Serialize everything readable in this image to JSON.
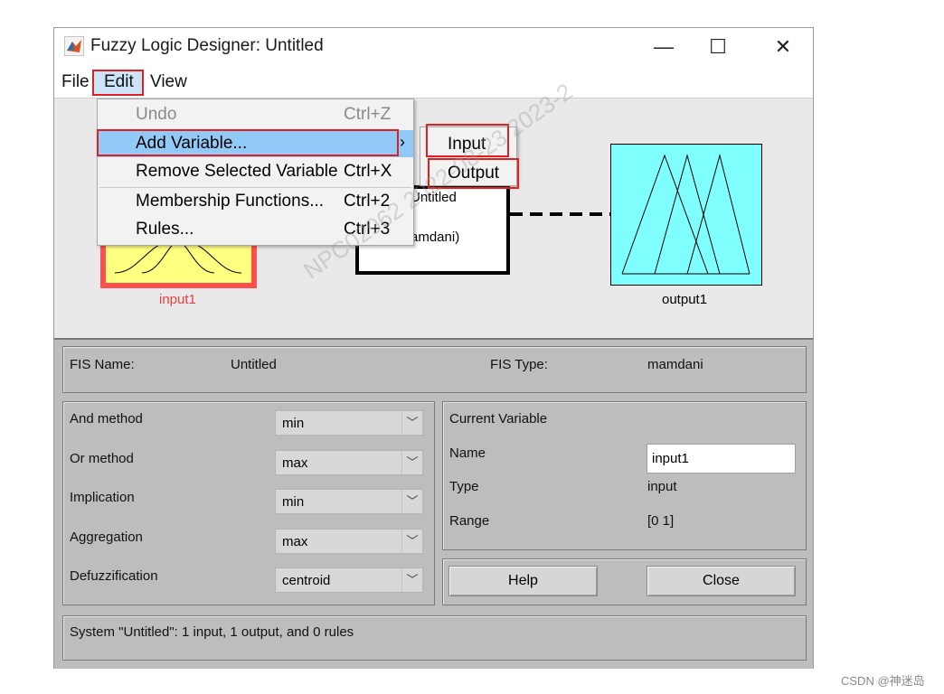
{
  "window": {
    "title": "Fuzzy Logic Designer: Untitled",
    "controls": {
      "minimize": "—",
      "maximize": "☐",
      "close": "✕"
    }
  },
  "menubar": {
    "file": "File",
    "edit": "Edit",
    "view": "View"
  },
  "edit_menu": {
    "items": [
      {
        "label": "Undo",
        "shortcut": "Ctrl+Z",
        "disabled": true
      },
      {
        "label": "Add Variable...",
        "shortcut": "",
        "highlighted": true,
        "submenu": true
      },
      {
        "label": "Remove Selected Variable",
        "shortcut": "Ctrl+X"
      },
      {
        "label": "Membership Functions...",
        "shortcut": "Ctrl+2"
      },
      {
        "label": "Rules...",
        "shortcut": "Ctrl+3"
      }
    ],
    "submenu_arrow": "›"
  },
  "add_variable_submenu": {
    "input": "Input",
    "output": "Output"
  },
  "diagram": {
    "input_label": "input1",
    "output_label": "output1",
    "fis_box_line1": "Untitled",
    "fis_box_line2": "amdani)",
    "input_color": "#ffff80",
    "input_border_color": "#ff4f4f",
    "output_color": "#80ffff"
  },
  "fis_info": {
    "name_label": "FIS Name:",
    "name_value": "Untitled",
    "type_label": "FIS Type:",
    "type_value": "mamdani"
  },
  "methods": {
    "and": {
      "label": "And method",
      "value": "min"
    },
    "or": {
      "label": "Or method",
      "value": "max"
    },
    "implication": {
      "label": "Implication",
      "value": "min"
    },
    "aggregation": {
      "label": "Aggregation",
      "value": "max"
    },
    "defuzzification": {
      "label": "Defuzzification",
      "value": "centroid"
    }
  },
  "current_variable": {
    "title": "Current Variable",
    "name_label": "Name",
    "name_value": "input1",
    "type_label": "Type",
    "type_value": "input",
    "range_label": "Range",
    "range_value": "[0 1]"
  },
  "buttons": {
    "help": "Help",
    "close": "Close"
  },
  "status": "System \"Untitled\": 1 input, 1 output, and 0 rules",
  "watermark": "NPC02962  2022-08-23  2023-2",
  "footer_credit": "CSDN @神迷岛"
}
